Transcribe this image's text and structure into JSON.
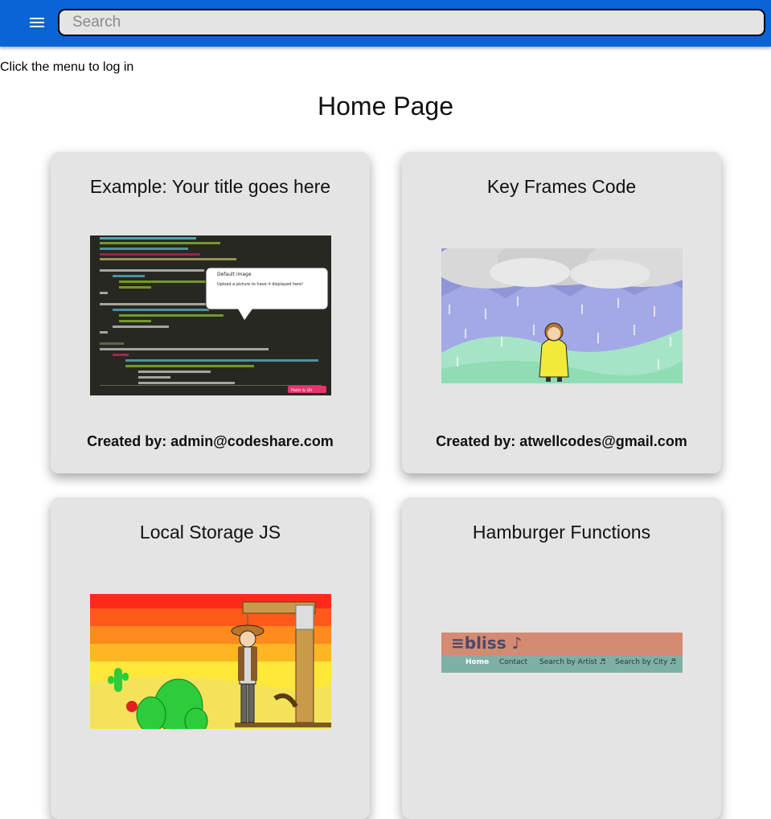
{
  "header": {
    "search_placeholder": "Search",
    "menu_icon": "hamburger-menu-icon",
    "bar_color": "#0a64d6"
  },
  "login_hint": "Click the menu to log in",
  "page_title": "Home Page",
  "cards": [
    {
      "title": "Example: Your title goes here",
      "author_label": "Created by: admin@codeshare.com",
      "image": "code-screenshot-thumbnail",
      "image_text": {
        "bubble_title": "Default image",
        "bubble_body": "Upload a picture to have it displayed here!",
        "badge": "Paint & Ulr"
      }
    },
    {
      "title": "Key Frames Code",
      "author_label": "Created by: atwellcodes@gmail.com",
      "image": "rain-girl-thumbnail"
    },
    {
      "title": "Local Storage JS",
      "author_label": "",
      "image": "desert-cowboy-thumbnail"
    },
    {
      "title": "Hamburger Functions",
      "author_label": "",
      "image": "bliss-nav-thumbnail",
      "image_text": {
        "logo": "≡bliss ♪",
        "nav_items": [
          "Home",
          "Contact",
          "Search by Artist ♬",
          "Search by City ♬"
        ]
      }
    }
  ]
}
